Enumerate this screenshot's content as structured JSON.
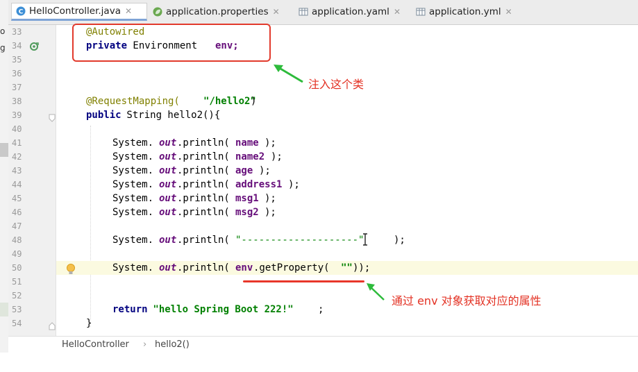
{
  "tabs": [
    {
      "label": "HelloController.java",
      "icon": "java-class-icon",
      "active": true
    },
    {
      "label": "application.properties",
      "icon": "spring-leaf-icon",
      "active": false
    },
    {
      "label": "application.yaml",
      "icon": "yaml-file-icon",
      "active": false
    },
    {
      "label": "application.yml",
      "icon": "yaml-file-icon",
      "active": false
    }
  ],
  "project_panel": {
    "fragment_1": "o",
    "fragment_2": "g"
  },
  "gutter": {
    "lines": [
      "33",
      "34",
      "35",
      "36",
      "37",
      "38",
      "39",
      "40",
      "41",
      "42",
      "43",
      "44",
      "45",
      "46",
      "47",
      "48",
      "49",
      "50",
      "51",
      "52",
      "53",
      "54"
    ]
  },
  "code": {
    "l33_annotation": "@Autowired",
    "l34_kw": "private",
    "l34_type": " Environment ",
    "l34_var": "env;",
    "l38_annotation": "@RequestMapping(",
    "l38_string": "\"/hello2\"",
    "l38_close": ")",
    "l39_kw": "public",
    "l39_rest": " String hello2(){",
    "sys": "System.",
    "out": "out",
    "println": ".println(",
    "close": ");",
    "args": [
      "name",
      "name2",
      "age",
      "address1",
      "msg1",
      "msg2"
    ],
    "l48_string": "\"--------------------\"",
    "l50_env": "env",
    "l50_call": ".getProperty(",
    "l50_string": "\"\"",
    "l50_close": "));",
    "l53_kw": "return",
    "l53_string": " \"hello Spring Boot 222!\"",
    "l53_semi": ";",
    "l54_brace": "}"
  },
  "annotations": {
    "note_inject": "注入这个类",
    "note_env": "通过 env 对象获取对应的属性",
    "box_color": "#e23a2c",
    "arrow_color": "#2dbb3b"
  },
  "breadcrumb": {
    "class": "HelloController",
    "sep": "›",
    "method": "hello2()"
  }
}
